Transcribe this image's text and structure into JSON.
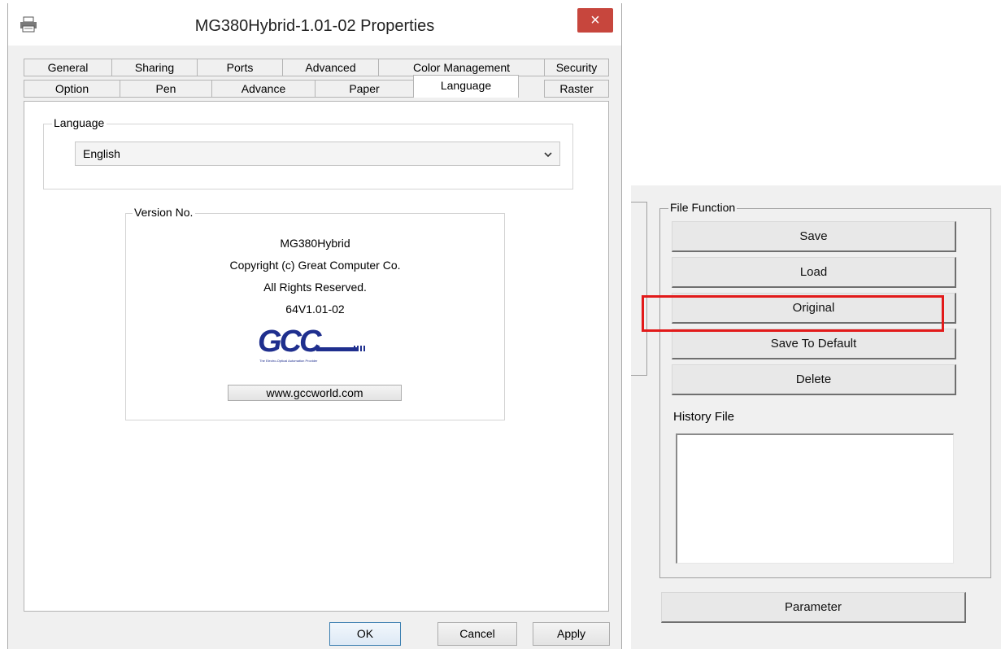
{
  "dialog": {
    "title": "MG380Hybrid-1.01-02 Properties",
    "close_glyph": "×",
    "tabs_row1": [
      "General",
      "Sharing",
      "Ports",
      "Advanced",
      "Color Management",
      "Security"
    ],
    "tabs_row2": [
      "Option",
      "Pen",
      "Advance",
      "Paper",
      "Language",
      "Raster"
    ],
    "active_tab": "Language",
    "language_group": {
      "legend": "Language",
      "selected": "English"
    },
    "version_group": {
      "legend": "Version No.",
      "model": "MG380Hybrid",
      "copyright": "Copyright (c) Great Computer Co.",
      "rights": "All Rights Reserved.",
      "version": "64V1.01-02",
      "logo_text": "GCC",
      "logo_tagline": "The Electro-Optical Automation Provider",
      "website_button": "www.gccworld.com"
    },
    "footer": {
      "ok": "OK",
      "cancel": "Cancel",
      "apply": "Apply"
    }
  },
  "file_panel": {
    "legend": "File Function",
    "buttons": [
      "Save",
      "Load",
      "Original",
      "Save To Default",
      "Delete"
    ],
    "highlighted": "Original",
    "history_label": "History File",
    "parameter_button": "Parameter"
  },
  "colors": {
    "close_button": "#c7463d",
    "highlight_box": "#e21a1a",
    "logo_blue": "#1f2f8e"
  },
  "icons": {
    "title": "printer-icon",
    "dropdown": "chevron-down-icon"
  }
}
